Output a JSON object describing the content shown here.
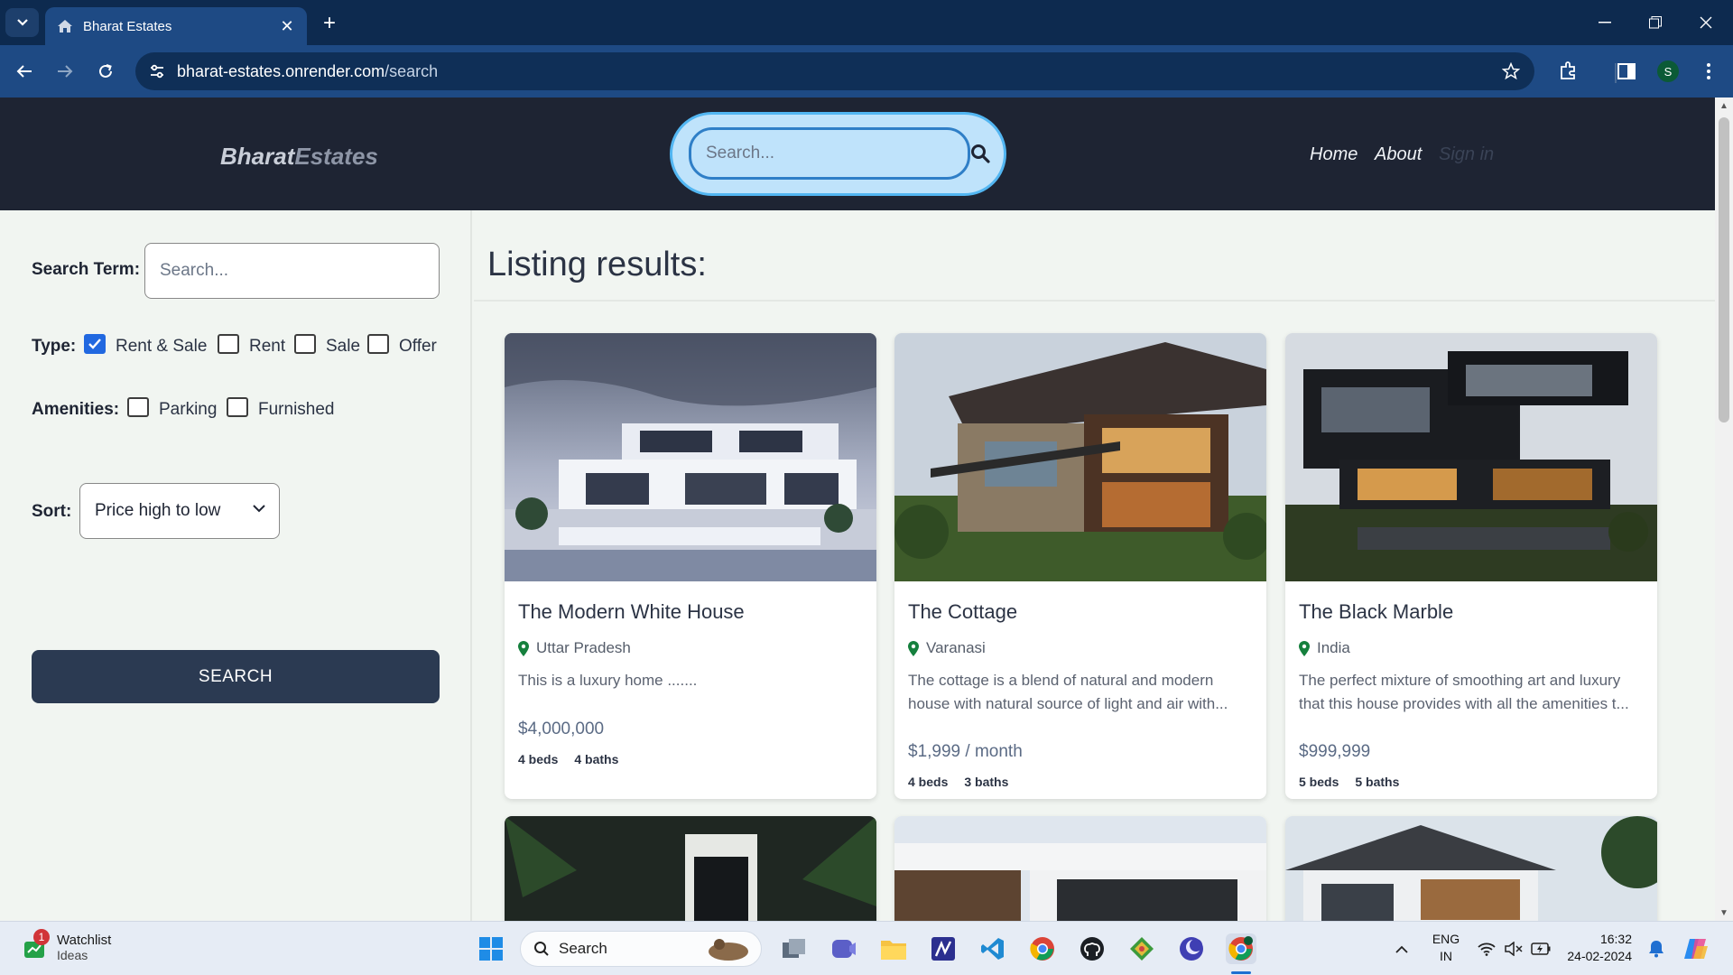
{
  "browser": {
    "tab_title": "Bharat Estates",
    "url_host": "bharat-estates.onrender.com",
    "url_path": "/search",
    "profile_initial": "S"
  },
  "header": {
    "logo_part1": "Bharat",
    "logo_part2": "Estates",
    "search_placeholder": "Search...",
    "nav": {
      "home": "Home",
      "about": "About",
      "sign_in": "Sign in"
    }
  },
  "filters": {
    "search_term_label": "Search Term:",
    "search_term_placeholder": "Search...",
    "type_label": "Type:",
    "types": [
      {
        "label": "Rent & Sale",
        "checked": true
      },
      {
        "label": "Rent",
        "checked": false
      },
      {
        "label": "Sale",
        "checked": false
      },
      {
        "label": "Offer",
        "checked": false
      }
    ],
    "amenities_label": "Amenities:",
    "amenities": [
      {
        "label": "Parking",
        "checked": false
      },
      {
        "label": "Furnished",
        "checked": false
      }
    ],
    "sort_label": "Sort:",
    "sort_value": "Price high to low",
    "search_button": "SEARCH"
  },
  "results": {
    "title": "Listing results:",
    "listings": [
      {
        "name": "The Modern White House",
        "location": "Uttar Pradesh",
        "description": "This is a luxury home .......",
        "price": "$4,000,000",
        "beds": "4 beds",
        "baths": "4 baths"
      },
      {
        "name": "The Cottage",
        "location": "Varanasi",
        "description": "The cottage is a blend of natural and modern house with natural source of light and air with...",
        "price": "$1,999 / month",
        "beds": "4 beds",
        "baths": "3 baths"
      },
      {
        "name": "The Black Marble",
        "location": "India",
        "description": "The perfect mixture of smoothing art and luxury that this house provides with all the amenities t...",
        "price": "$999,999",
        "beds": "5 beds",
        "baths": "5 baths"
      }
    ]
  },
  "taskbar": {
    "widget_title": "Watchlist",
    "widget_subtitle": "Ideas",
    "widget_badge": "1",
    "search_label": "Search",
    "lang_line1": "ENG",
    "lang_line2": "IN",
    "time": "16:32",
    "date": "24-02-2024"
  }
}
